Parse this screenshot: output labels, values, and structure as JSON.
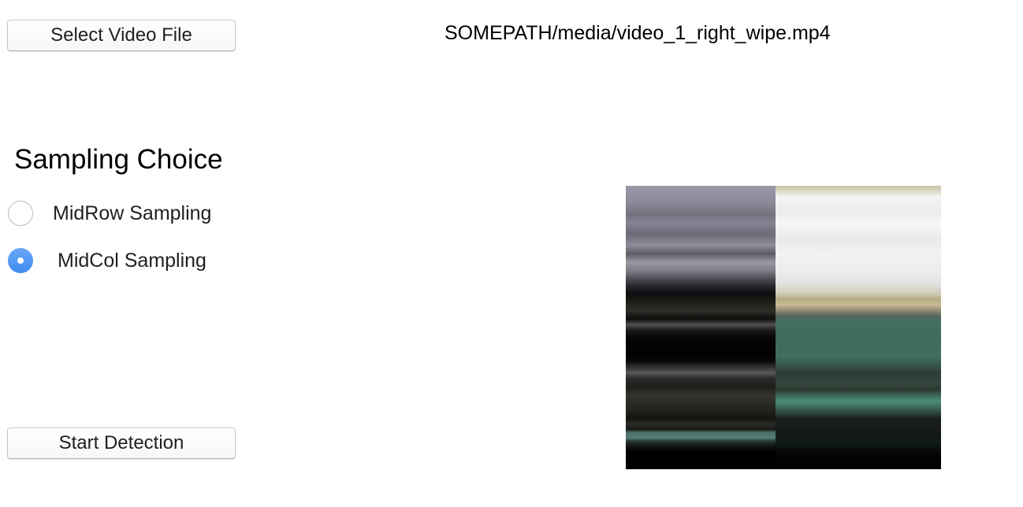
{
  "toolbar": {
    "select_label": "Select Video File",
    "file_path": "SOMEPATH/media/video_1_right_wipe.mp4"
  },
  "sampling": {
    "title": "Sampling Choice",
    "options": [
      {
        "label": "MidRow Sampling",
        "checked": false
      },
      {
        "label": "MidCol Sampling",
        "checked": true
      }
    ]
  },
  "actions": {
    "start_label": "Start Detection"
  },
  "colors": {
    "radio_selected": "#4a90f0",
    "background": "#ffffff"
  },
  "preview": {
    "icon": "sti-image-preview"
  }
}
